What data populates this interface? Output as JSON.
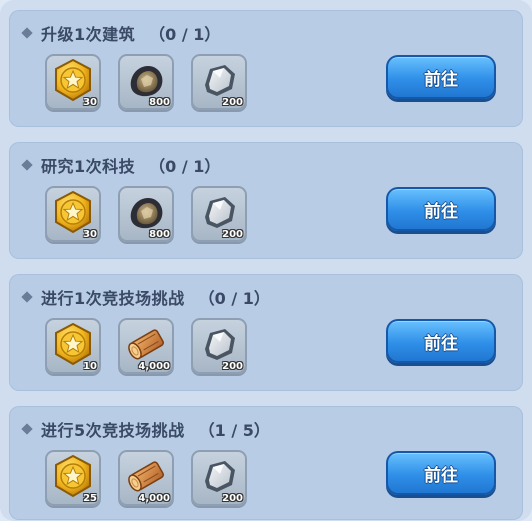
{
  "tasks": [
    {
      "title": "升级1次建筑",
      "progress": "（0 / 1）",
      "button_label": "前往",
      "rewards": [
        {
          "icon": "gold-star-coin-icon",
          "count": "30"
        },
        {
          "icon": "ore-icon",
          "count": "800"
        },
        {
          "icon": "stone-icon",
          "count": "200"
        }
      ]
    },
    {
      "title": "研究1次科技",
      "progress": "（0 / 1）",
      "button_label": "前往",
      "rewards": [
        {
          "icon": "gold-star-coin-icon",
          "count": "30"
        },
        {
          "icon": "ore-icon",
          "count": "800"
        },
        {
          "icon": "stone-icon",
          "count": "200"
        }
      ]
    },
    {
      "title": "进行1次竞技场挑战",
      "progress": "（0 / 1）",
      "button_label": "前往",
      "rewards": [
        {
          "icon": "gold-star-coin-icon",
          "count": "10"
        },
        {
          "icon": "wood-log-icon",
          "count": "4,000"
        },
        {
          "icon": "stone-icon",
          "count": "200"
        }
      ]
    },
    {
      "title": "进行5次竞技场挑战",
      "progress": "（1 / 5）",
      "button_label": "前往",
      "rewards": [
        {
          "icon": "gold-star-coin-icon",
          "count": "25"
        },
        {
          "icon": "wood-log-icon",
          "count": "4,000"
        },
        {
          "icon": "stone-icon",
          "count": "200"
        }
      ]
    }
  ],
  "colors": {
    "button": "#2f8fe8",
    "card": "#b8cde5",
    "panel": "#cfddef"
  }
}
